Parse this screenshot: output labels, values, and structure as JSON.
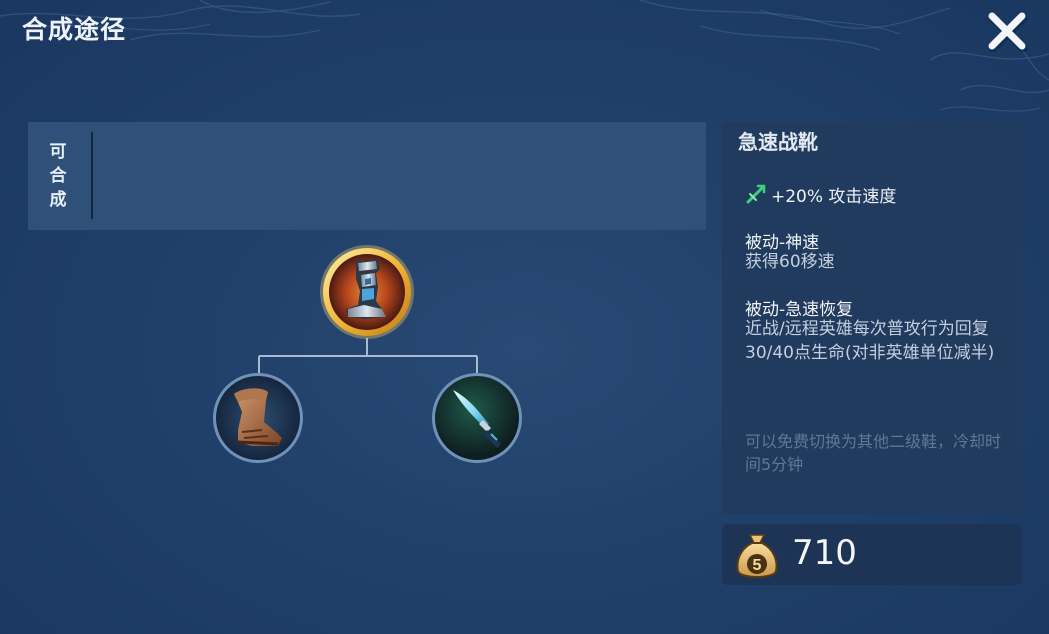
{
  "header": {
    "title": "合成途径"
  },
  "compose": {
    "label": "可\n合\n成"
  },
  "tree": {
    "root": {
      "icon": "speed-boots-icon"
    },
    "children": [
      {
        "icon": "leather-boots-icon"
      },
      {
        "icon": "dagger-icon"
      }
    ]
  },
  "item": {
    "name": "急速战靴",
    "stat": {
      "icon": "attack-speed-icon",
      "text": "+20% 攻击速度"
    },
    "passives": [
      {
        "title": "被动-神速",
        "desc": "获得60移速"
      },
      {
        "title": "被动-急速恢复",
        "desc": "近战/远程英雄每次普攻行为回复30/40点生命(对非英雄单位减半)"
      }
    ],
    "note": "可以免费切换为其他二级鞋，冷却时间5分钟"
  },
  "price": {
    "icon": "gold-bag-icon",
    "value": "710"
  },
  "colors": {
    "background": "#20406a",
    "panel": "#213b5e",
    "gold_ring": "#f2b638",
    "muted_text": "#5e7898"
  }
}
